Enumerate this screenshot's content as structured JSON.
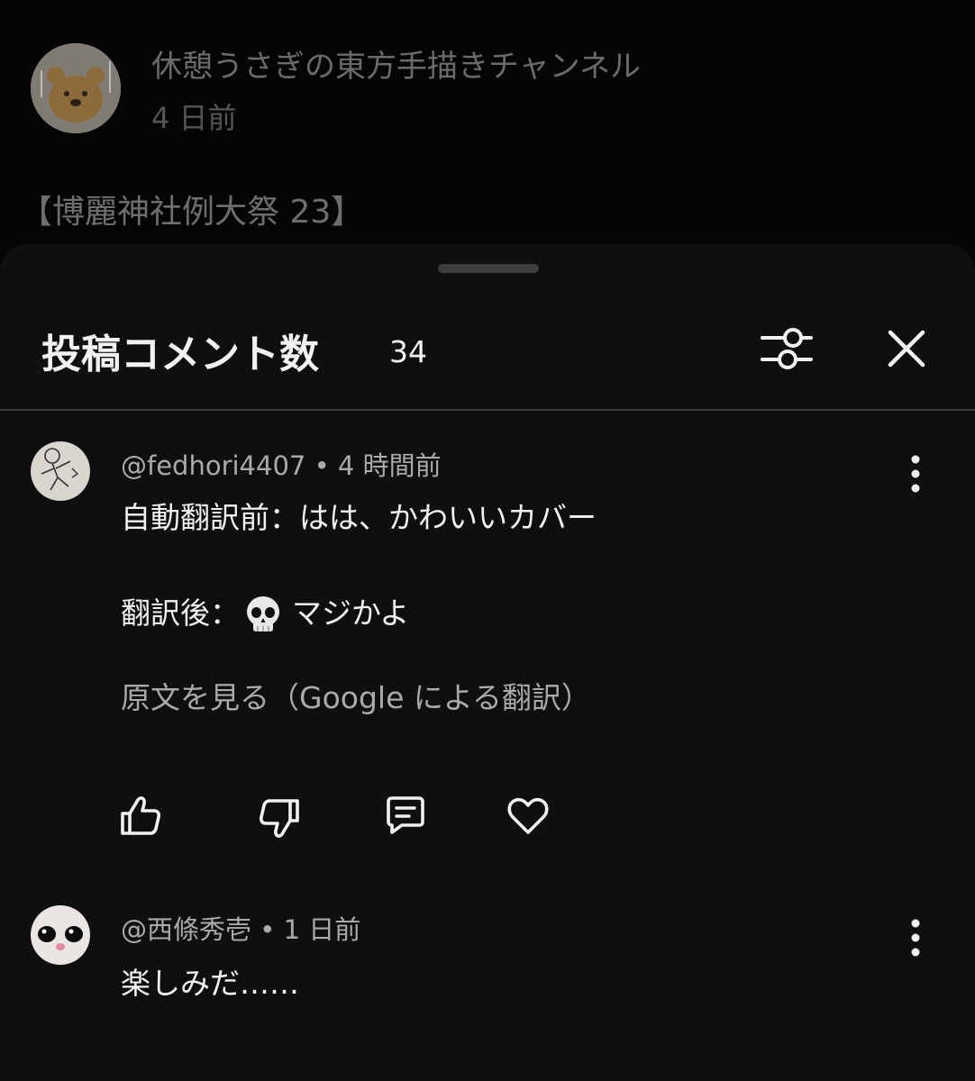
{
  "post": {
    "channel_name": "休憩うさぎの東方手描きチャンネル",
    "time_ago": "4 日前",
    "title_text": "【博麗神社例大祭 23】"
  },
  "comments_sheet": {
    "title": "投稿コメント数",
    "count": "34",
    "filter_icon": "sliders-icon",
    "close_icon": "close-icon"
  },
  "comments": [
    {
      "author": "@fedhori4407",
      "separator": "•",
      "time_ago": "4 時間前",
      "line_1": "自動翻訳前：はは、かわいいカバー",
      "line_2_prefix": "翻訳後：",
      "line_2_emoji": "skull-emoji",
      "line_2_suffix": "マジかよ",
      "translation_link": "原文を見る（Google による翻訳）",
      "actions": [
        "thumbs-up-icon",
        "thumbs-down-icon",
        "reply-icon",
        "heart-icon"
      ]
    },
    {
      "author": "@西條秀壱",
      "separator": "•",
      "time_ago": "1 日前",
      "text": "楽しみだ……"
    }
  ]
}
